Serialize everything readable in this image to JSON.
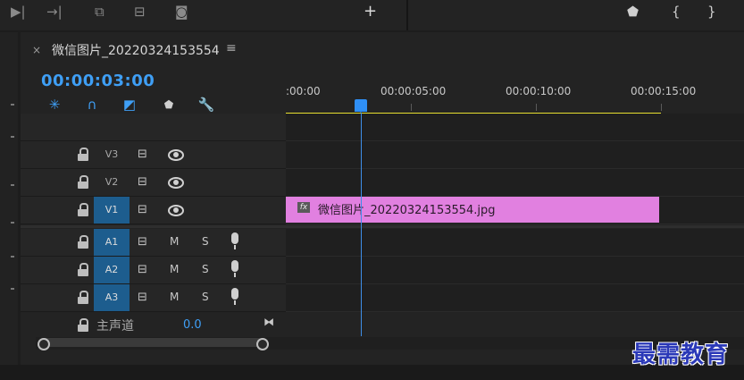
{
  "sequence": {
    "title": "微信图片_20220324153554",
    "timecode": "00:00:03:00"
  },
  "ruler": {
    "labels": [
      ":00:00",
      "00:00:05:00",
      "00:00:10:00",
      "00:00:15:00"
    ]
  },
  "tracks": {
    "video": [
      {
        "label": "V3",
        "active": false
      },
      {
        "label": "V2",
        "active": false
      },
      {
        "label": "V1",
        "active": true
      }
    ],
    "audio": [
      {
        "label": "A1",
        "mute": "M",
        "solo": "S"
      },
      {
        "label": "A2",
        "mute": "M",
        "solo": "S"
      },
      {
        "label": "A3",
        "mute": "M",
        "solo": "S"
      }
    ],
    "master": {
      "label": "主声道",
      "value": "0.0"
    }
  },
  "clip": {
    "name": "微信图片_20220324153554.jpg",
    "badge": "fx",
    "color": "#e180e0"
  },
  "colors": {
    "accent": "#3f9ff5",
    "active_track": "#1d5d8e",
    "work_area": "#e6df2f"
  },
  "watermark": "最需教育"
}
